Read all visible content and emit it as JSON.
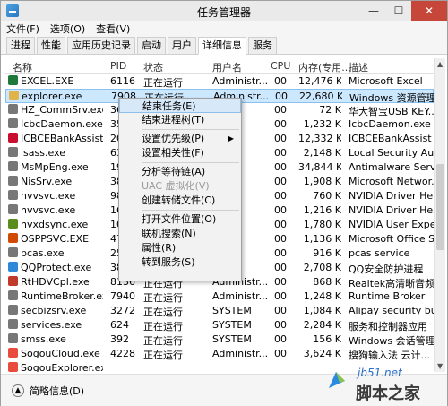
{
  "window": {
    "title": "任务管理器",
    "controls": [
      "—",
      "☐",
      "✕"
    ]
  },
  "menu": [
    "文件(F)",
    "选项(O)",
    "查看(V)"
  ],
  "tabs": [
    "进程",
    "性能",
    "应用历史记录",
    "启动",
    "用户",
    "详细信息",
    "服务"
  ],
  "active_tab": "详细信息",
  "table": {
    "headers": {
      "name": "名称",
      "pid": "PID",
      "status": "状态",
      "user": "用户名",
      "cpu": "CPU",
      "mem": "内存(专用...",
      "desc": "描述"
    },
    "rows": [
      {
        "name": "EXCEL.EXE",
        "pid": "6116",
        "status": "正在运行",
        "user": "Administr...",
        "cpu": "00",
        "mem": "12,476 K",
        "desc": "Microsoft Excel",
        "icon": "#1f7a3a"
      },
      {
        "name": "explorer.exe",
        "pid": "7908",
        "status": "正在运行",
        "user": "Administr...",
        "cpu": "00",
        "mem": "22,680 K",
        "desc": "Windows 资源管理器",
        "icon": "#e1b44b",
        "selected": true
      },
      {
        "name": "HZ_CommSrv.exe",
        "pid": "36",
        "status": "",
        "user": "",
        "cpu": "00",
        "mem": "72 K",
        "desc": "华大智宝USB KEY...",
        "icon": "#777777"
      },
      {
        "name": "IcbcDaemon.exe",
        "pid": "35",
        "status": "",
        "user": "",
        "cpu": "00",
        "mem": "1,232 K",
        "desc": "IcbcDaemon.exe",
        "icon": "#777777"
      },
      {
        "name": "ICBCEBankAssist.e...",
        "pid": "20",
        "status": "",
        "user": "",
        "cpu": "00",
        "mem": "12,332 K",
        "desc": "ICBCEBankAssist",
        "icon": "#c8102e"
      },
      {
        "name": "lsass.exe",
        "pid": "63",
        "status": "",
        "user": "",
        "cpu": "00",
        "mem": "2,148 K",
        "desc": "Local Security Aut...",
        "icon": "#777777"
      },
      {
        "name": "MsMpEng.exe",
        "pid": "19",
        "status": "",
        "user": "",
        "cpu": "00",
        "mem": "34,844 K",
        "desc": "Antimalware Servi...",
        "icon": "#777777"
      },
      {
        "name": "NisSrv.exe",
        "pid": "38",
        "status": "",
        "user": "",
        "cpu": "00",
        "mem": "1,908 K",
        "desc": "Microsoft Networ...",
        "icon": "#777777"
      },
      {
        "name": "nvvsvc.exe",
        "pid": "98",
        "status": "",
        "user": "",
        "cpu": "00",
        "mem": "760 K",
        "desc": "NVIDIA Driver Hel...",
        "icon": "#777777"
      },
      {
        "name": "nvvsvc.exe",
        "pid": "16",
        "status": "",
        "user": "",
        "cpu": "00",
        "mem": "1,216 K",
        "desc": "NVIDIA Driver Hel...",
        "icon": "#777777"
      },
      {
        "name": "nvxdsync.exe",
        "pid": "10",
        "status": "",
        "user": "",
        "cpu": "00",
        "mem": "1,780 K",
        "desc": "NVIDIA User Expe...",
        "icon": "#5a8c1e"
      },
      {
        "name": "OSPPSVC.EXE",
        "pid": "47",
        "status": "",
        "user": "",
        "cpu": "00",
        "mem": "1,136 K",
        "desc": "Microsoft Office S...",
        "icon": "#d04a02"
      },
      {
        "name": "pcas.exe",
        "pid": "25",
        "status": "",
        "user": "",
        "cpu": "00",
        "mem": "916 K",
        "desc": "pcas service",
        "icon": "#777777"
      },
      {
        "name": "QQProtect.exe",
        "pid": "38",
        "status": "",
        "user": "",
        "cpu": "00",
        "mem": "2,708 K",
        "desc": "QQ安全防护进程",
        "icon": "#2e8ad8"
      },
      {
        "name": "RtHDVCpl.exe",
        "pid": "8136",
        "status": "正在运行",
        "user": "Administr...",
        "cpu": "00",
        "mem": "868 K",
        "desc": "Realtek高清晰音频...",
        "icon": "#c0392b"
      },
      {
        "name": "RuntimeBroker.exe",
        "pid": "7940",
        "status": "正在运行",
        "user": "Administr...",
        "cpu": "00",
        "mem": "1,248 K",
        "desc": "Runtime Broker",
        "icon": "#777777"
      },
      {
        "name": "secbizsrv.exe",
        "pid": "3272",
        "status": "正在运行",
        "user": "SYSTEM",
        "cpu": "00",
        "mem": "1,084 K",
        "desc": "Alipay security bus...",
        "icon": "#777777"
      },
      {
        "name": "services.exe",
        "pid": "624",
        "status": "正在运行",
        "user": "SYSTEM",
        "cpu": "00",
        "mem": "2,284 K",
        "desc": "服务和控制器应用",
        "icon": "#777777"
      },
      {
        "name": "smss.exe",
        "pid": "392",
        "status": "正在运行",
        "user": "SYSTEM",
        "cpu": "00",
        "mem": "156 K",
        "desc": "Windows 会话管理器",
        "icon": "#777777"
      },
      {
        "name": "SogouCloud.exe",
        "pid": "4228",
        "status": "正在运行",
        "user": "Administr...",
        "cpu": "00",
        "mem": "3,624 K",
        "desc": "搜狗输入法 云计...",
        "icon": "#e74c3c"
      },
      {
        "name": "SogouExplorer.exe",
        "pid": "",
        "status": "",
        "user": "",
        "cpu": "",
        "mem": "",
        "desc": "",
        "icon": "#e74c3c"
      }
    ]
  },
  "context_menu": {
    "items": [
      {
        "label": "结束任务(E)",
        "highlight": true
      },
      {
        "label": "结束进程树(T)"
      },
      {
        "sep": true
      },
      {
        "label": "设置优先级(P)",
        "submenu": true
      },
      {
        "label": "设置相关性(F)"
      },
      {
        "sep": true
      },
      {
        "label": "分析等待链(A)"
      },
      {
        "label": "UAC 虚拟化(V)",
        "disabled": true
      },
      {
        "label": "创建转储文件(C)"
      },
      {
        "sep": true
      },
      {
        "label": "打开文件位置(O)"
      },
      {
        "label": "联机搜索(N)"
      },
      {
        "label": "属性(R)"
      },
      {
        "label": "转到服务(S)"
      }
    ]
  },
  "footer": {
    "text": "简略信息(D)"
  },
  "watermark": {
    "url": "jb51.net",
    "name": "脚本之家"
  }
}
